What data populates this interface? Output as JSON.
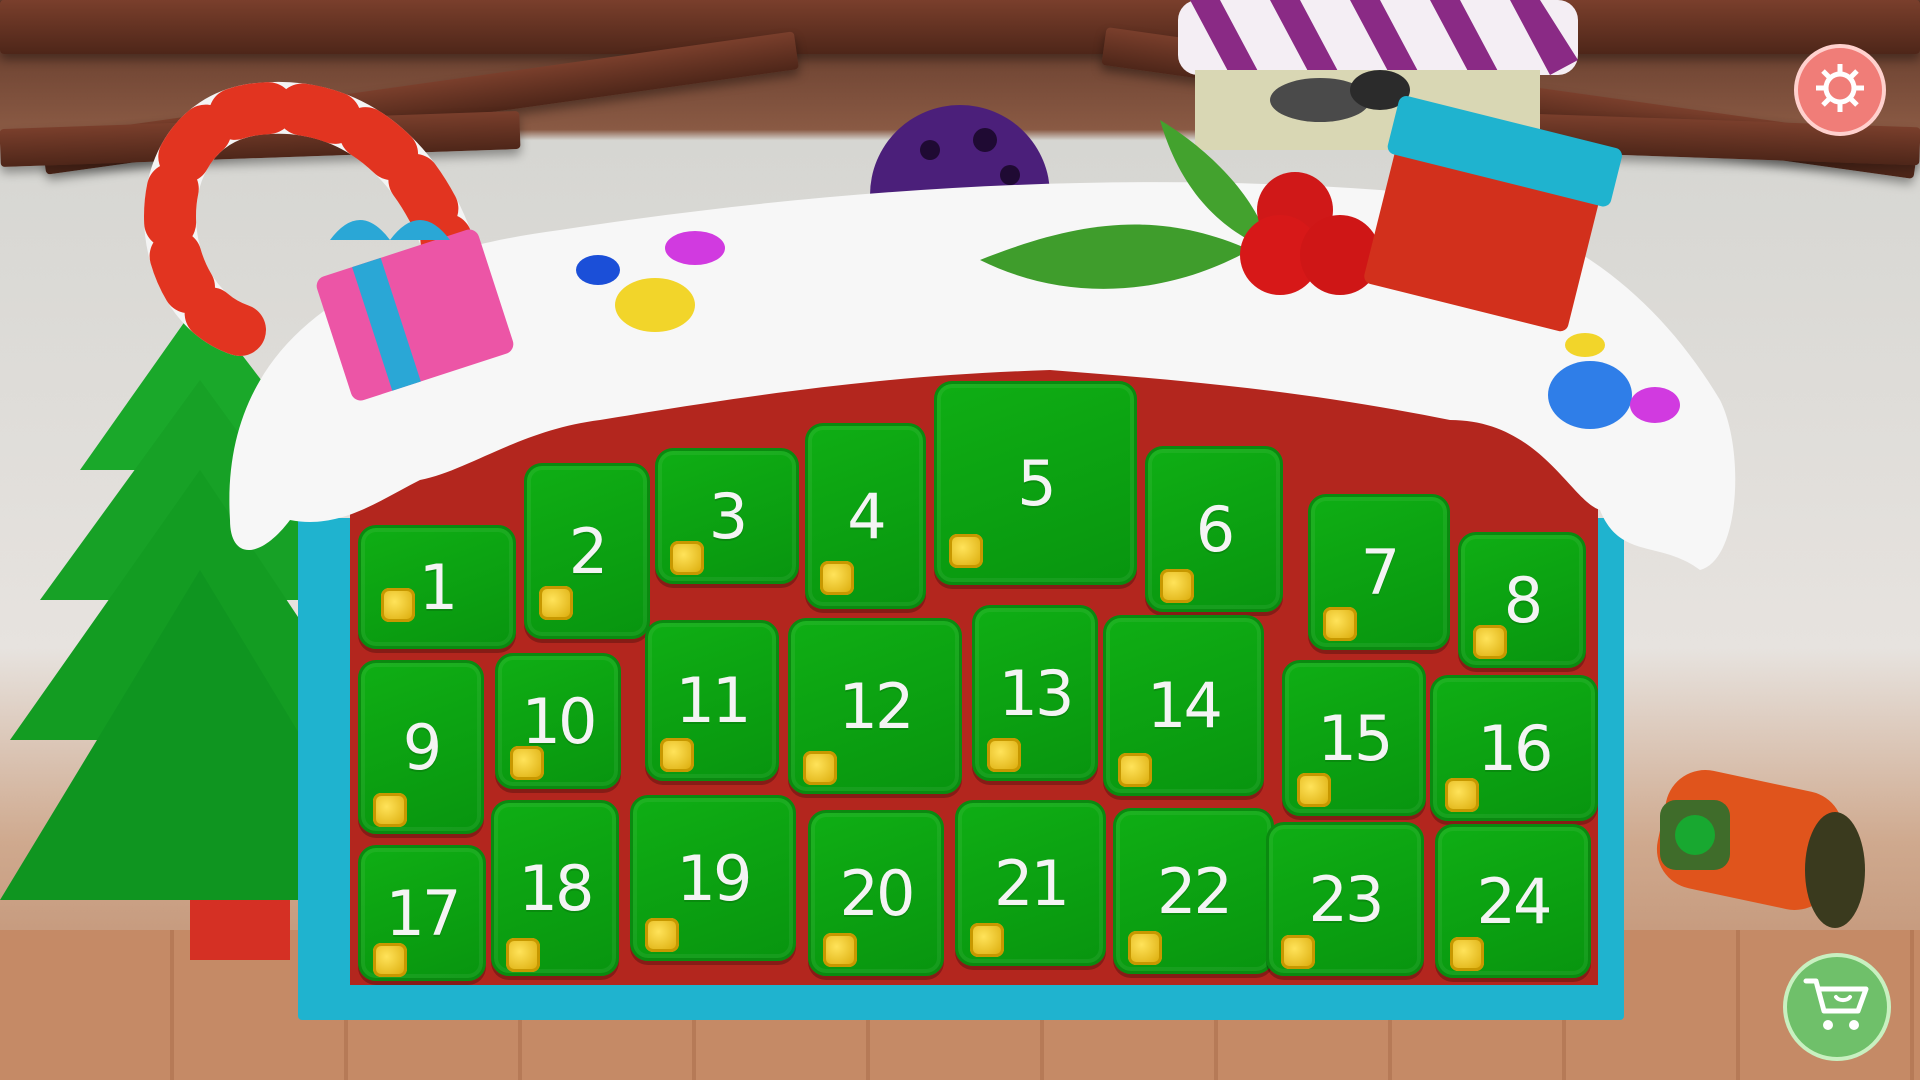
{
  "calendar": {
    "doors": [
      {
        "day": "1"
      },
      {
        "day": "2"
      },
      {
        "day": "3"
      },
      {
        "day": "4"
      },
      {
        "day": "5"
      },
      {
        "day": "6"
      },
      {
        "day": "7"
      },
      {
        "day": "8"
      },
      {
        "day": "9"
      },
      {
        "day": "10"
      },
      {
        "day": "11"
      },
      {
        "day": "12"
      },
      {
        "day": "13"
      },
      {
        "day": "14"
      },
      {
        "day": "15"
      },
      {
        "day": "16"
      },
      {
        "day": "17"
      },
      {
        "day": "18"
      },
      {
        "day": "19"
      },
      {
        "day": "20"
      },
      {
        "day": "21"
      },
      {
        "day": "22"
      },
      {
        "day": "23"
      },
      {
        "day": "24"
      }
    ],
    "door_color": "#0faa13",
    "frame_color": "#1fb3cf",
    "back_color": "#b3261e",
    "lock_color": "#f2cc20"
  },
  "buttons": {
    "settings_icon": "gear-icon",
    "shop_icon": "shopping-cart-icon"
  },
  "scene": {
    "decorations": [
      "christmas-tree",
      "candy-cane",
      "gift-box",
      "holly-berries",
      "red-present",
      "ornament-ball",
      "rolled-poster",
      "music-speaker"
    ]
  }
}
